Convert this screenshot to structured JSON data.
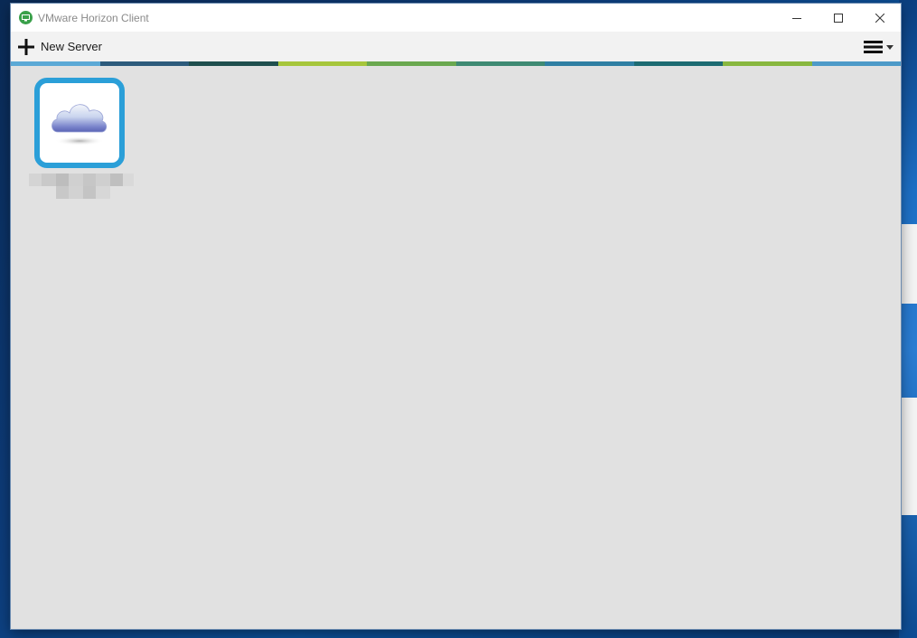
{
  "window": {
    "title": "VMware Horizon Client",
    "controls": {
      "minimize_icon": "minimize-icon",
      "maximize_icon": "maximize-icon",
      "close_icon": "close-icon"
    }
  },
  "toolbar": {
    "new_server_label": "New Server",
    "new_server_icon": "plus-icon",
    "menu_icon": "hamburger-menu-icon"
  },
  "servers": [
    {
      "icon": "cloud-icon",
      "name_redacted": true,
      "selected": true
    }
  ],
  "colors": {
    "accent": "#2b9fd8",
    "app_icon": "#3aa04a",
    "stripe": [
      "#5ba9d6",
      "#2d5b7c",
      "#1f4f4e",
      "#a6c63b",
      "#6aa84f",
      "#3f8a73",
      "#2f7fa3",
      "#1d6b72",
      "#88b73f",
      "#4d9ac8"
    ]
  }
}
